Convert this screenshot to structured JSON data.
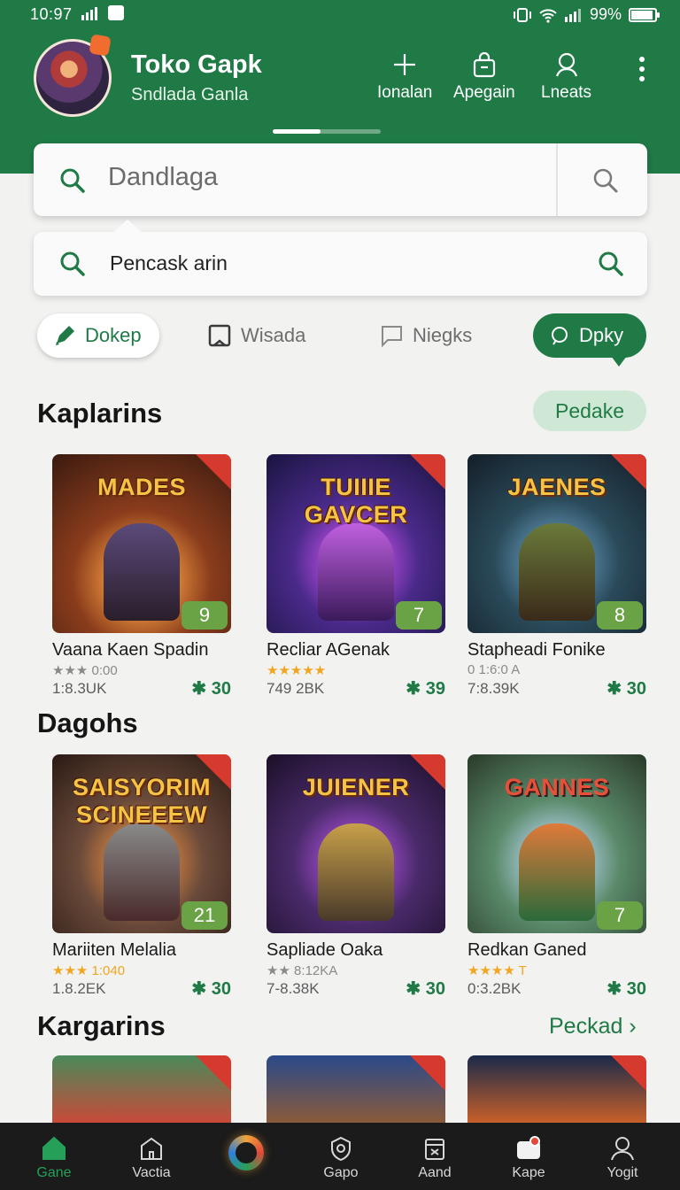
{
  "status": {
    "time": "10:97 ",
    "battery": "99%"
  },
  "header": {
    "title": "Toko Gapk",
    "subtitle": "Sndlada Ganla",
    "actions": [
      {
        "label": "Ionalan",
        "icon": "plus-icon"
      },
      {
        "label": "Apegain",
        "icon": "bag-icon"
      },
      {
        "label": "Lneats",
        "icon": "person-search-icon"
      }
    ]
  },
  "search": {
    "query": "Dandlaga",
    "suggestion": "Pencask arin"
  },
  "chips": [
    {
      "label": "Dokep",
      "icon": "pencil-icon",
      "active": true
    },
    {
      "label": "Wisada",
      "icon": "bookmark-icon"
    },
    {
      "label": "Niegks",
      "icon": "chat-icon"
    },
    {
      "label": "Dpky",
      "icon": "chat-bubble-icon",
      "selected": true
    }
  ],
  "sections": [
    {
      "title": "Kaplarins",
      "action": "Pedake",
      "cards": [
        {
          "logo": "MADES",
          "name": "Vaana Kaen Spadin",
          "rating": "★★★ 0:00",
          "meta": "1:8.3UK",
          "score": "30",
          "badge": "9"
        },
        {
          "logo": "TUIIIE GAVCER",
          "name": "Recliar AGenak",
          "rating": "★★★★★",
          "meta": "749 2BK",
          "score": "39",
          "badge": "7"
        },
        {
          "logo": "JAENES",
          "name": "Stapheadi Fonike",
          "rating": "0 1:6:0 A",
          "meta": "7:8.39K",
          "score": "30",
          "badge": "8"
        }
      ]
    },
    {
      "title": "Dagohs",
      "cards": [
        {
          "logo": "SAISYORIM SCINEEEW",
          "name": "Mariiten Melalia",
          "rating": "★★★ 1:040",
          "meta": "1.8.2EK",
          "score": "30",
          "badge": "21"
        },
        {
          "logo": "JUIENER",
          "name": "Sapliade Oaka",
          "rating": "★★ 8:12KA",
          "meta": "7-8.38K",
          "score": "30",
          "badge": ""
        },
        {
          "logo": "GANNES",
          "name": "Redkan Ganed",
          "rating": "★★★★ T",
          "meta": "0:3.2BK",
          "score": "30",
          "badge": "7"
        }
      ]
    },
    {
      "title": "Kargarins",
      "action": "Peckad ›"
    }
  ],
  "bottom_nav": [
    {
      "label": "Gane",
      "icon": "home-icon",
      "active": true
    },
    {
      "label": "Vactia",
      "icon": "building-icon"
    },
    {
      "label": "Gapo",
      "icon": "shield-icon"
    },
    {
      "label": "Aand",
      "icon": "box-icon"
    },
    {
      "label": "Kape",
      "icon": "camera-icon"
    },
    {
      "label": "Yogit",
      "icon": "user-icon"
    }
  ],
  "colors": {
    "brand": "#1f7a46",
    "accent": "#26a058",
    "badge": "#6aa246",
    "corner": "#d63a2e"
  }
}
